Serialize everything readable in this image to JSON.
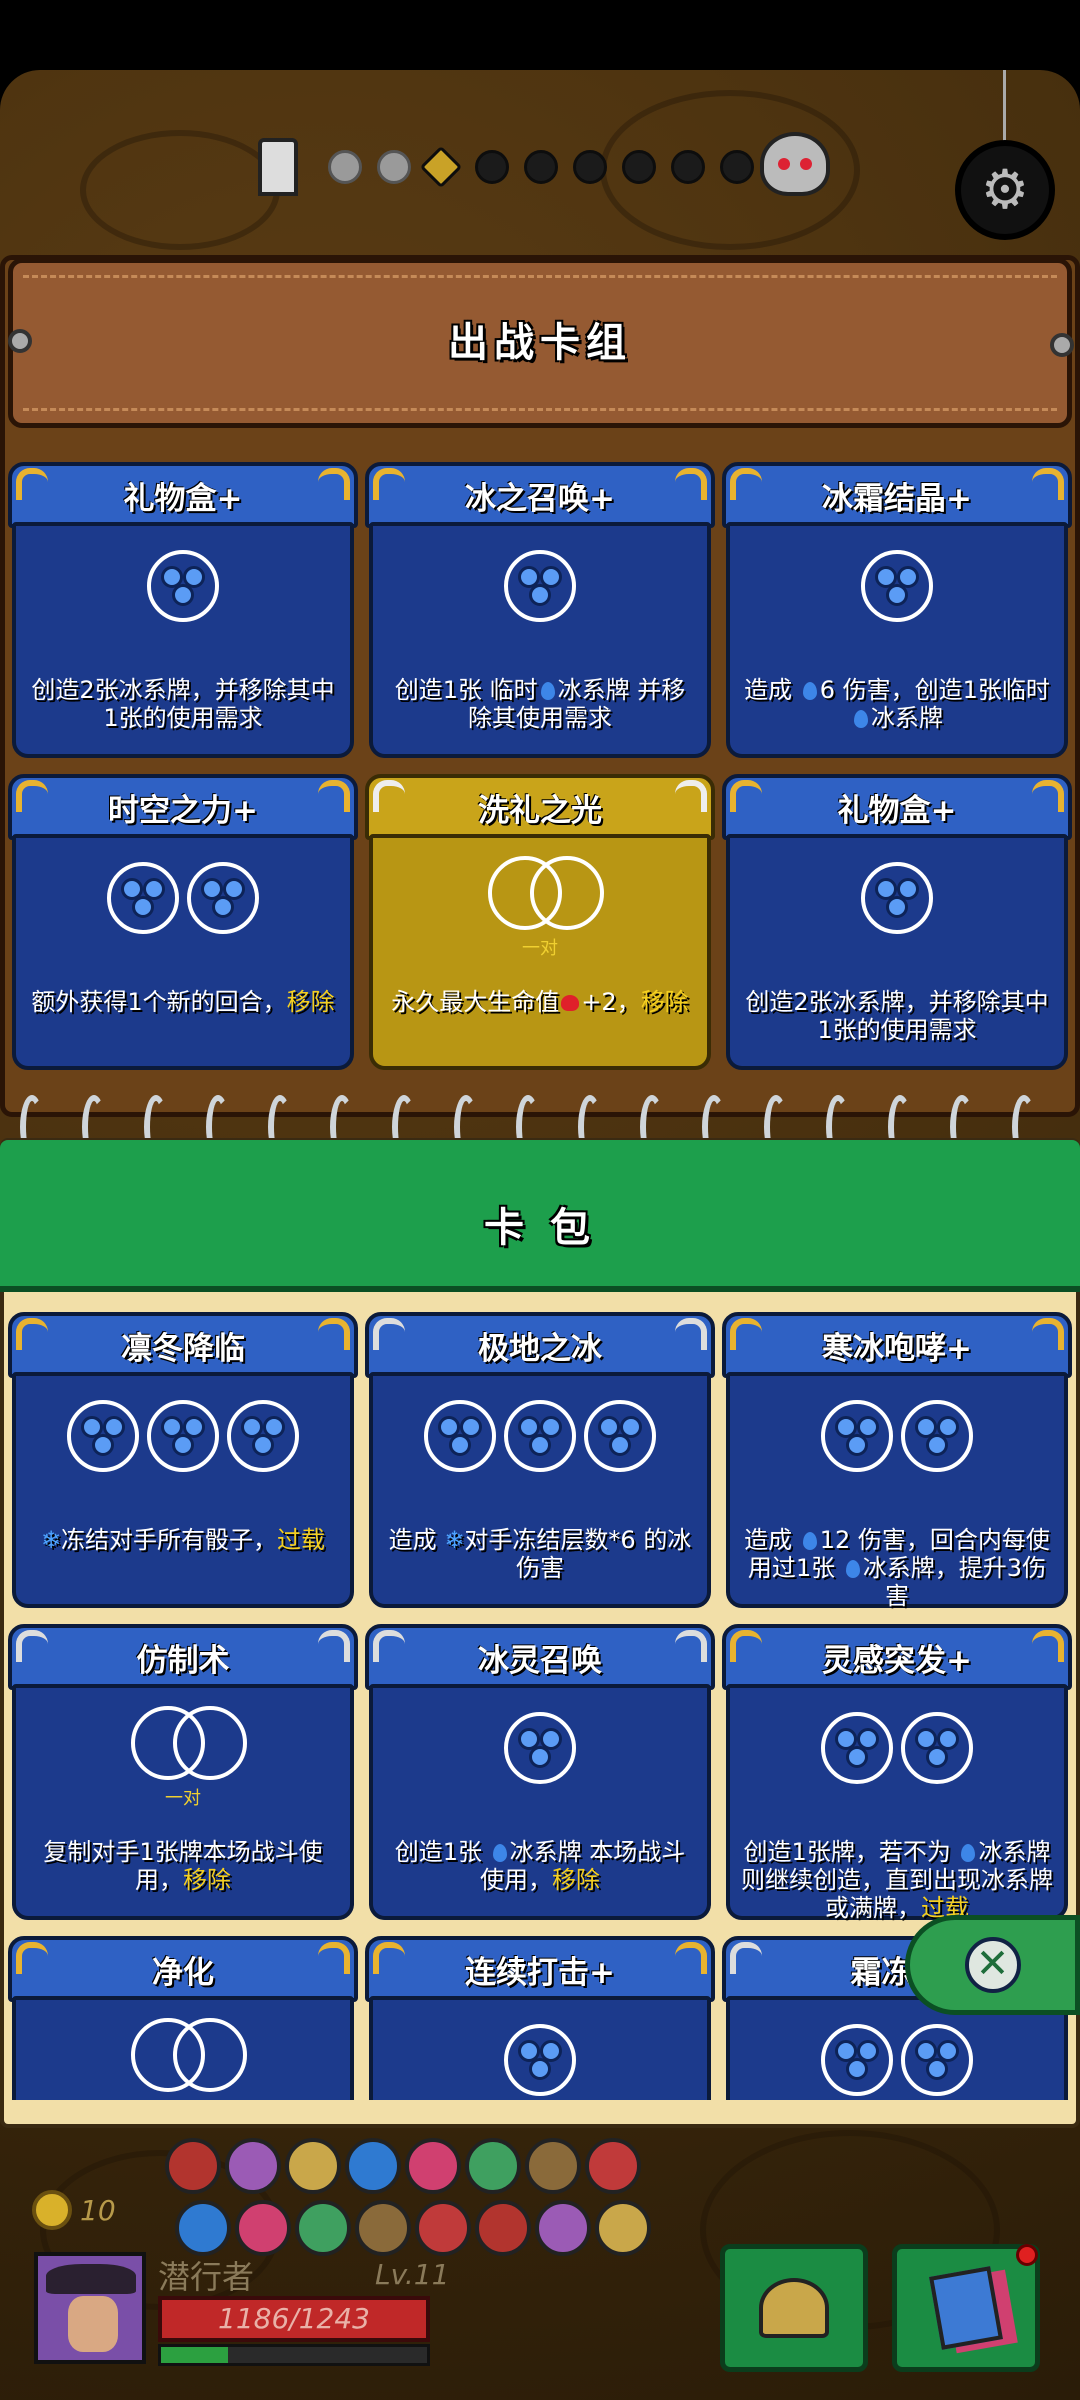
{
  "map": {
    "stages": [
      "done",
      "done",
      "current",
      "locked",
      "locked",
      "locked",
      "locked",
      "locked",
      "locked"
    ]
  },
  "deck": {
    "title": "出战卡组",
    "cards": [
      {
        "name": "礼物盒+",
        "slots": [
          "ice"
        ],
        "desc": "创造2张冰系牌，并移除其中1张的使用需求",
        "variant": "blue"
      },
      {
        "name": "冰之召唤+",
        "slots": [
          "ice"
        ],
        "desc": "创造1张 临时💧冰系牌 并移除其使用需求",
        "variant": "blue"
      },
      {
        "name": "冰霜结晶+",
        "slots": [
          "ice"
        ],
        "desc": "造成 💧6 伤害，创造1张临时💧冰系牌",
        "variant": "blue"
      },
      {
        "name": "时空之力+",
        "slots": [
          "ice",
          "ice"
        ],
        "desc": "额外获得1个新的回合，",
        "highlight": "移除",
        "variant": "blue"
      },
      {
        "name": "洗礼之光",
        "slots": [
          "pair"
        ],
        "pair_label": "一对",
        "desc": "永久最大生命值❤+2，",
        "highlight": "移除",
        "variant": "gold"
      },
      {
        "name": "礼物盒+",
        "slots": [
          "ice"
        ],
        "desc": "创造2张冰系牌，并移除其中1张的使用需求",
        "variant": "blue"
      }
    ]
  },
  "pack": {
    "title": "卡 包",
    "cards": [
      {
        "name": "凛冬降临",
        "slots": [
          "ice",
          "ice",
          "ice"
        ],
        "desc": "❄冻结对手所有骰子，",
        "highlight": "过载",
        "variant": "blue"
      },
      {
        "name": "极地之冰",
        "slots": [
          "ice",
          "ice",
          "ice"
        ],
        "desc": "造成 ❄对手冻结层数*6 的冰伤害",
        "variant": "plain"
      },
      {
        "name": "寒冰咆哮+",
        "slots": [
          "ice",
          "ice"
        ],
        "desc": "造成 💧12 伤害，回合内每使用过1张 💧冰系牌，提升3伤害",
        "variant": "blue"
      },
      {
        "name": "仿制术",
        "slots": [
          "pair"
        ],
        "pair_label": "一对",
        "desc": "复制对手1张牌本场战斗使用，",
        "highlight": "移除",
        "variant": "plain"
      },
      {
        "name": "冰灵召唤",
        "slots": [
          "ice"
        ],
        "desc": "创造1张 💧冰系牌 本场战斗使用，",
        "highlight": "移除",
        "variant": "plain"
      },
      {
        "name": "灵感突发+",
        "slots": [
          "ice",
          "ice"
        ],
        "desc": "创造1张牌，若不为 💧冰系牌则继续创造，直到出现冰系牌或满牌，",
        "highlight": "过载",
        "variant": "blue"
      },
      {
        "name": "净化",
        "slots": [
          "pair"
        ],
        "pair_label": "一对",
        "desc": "",
        "variant": "blue"
      },
      {
        "name": "连续打击+",
        "slots": [
          "ice"
        ],
        "desc": "",
        "variant": "blue"
      },
      {
        "name": "霜冻结",
        "slots": [
          "ice",
          "ice"
        ],
        "desc": "",
        "variant": "plain"
      }
    ]
  },
  "player": {
    "coins": "10",
    "name": "潜行者",
    "level": "Lv.11",
    "hp": "1186/1243",
    "xp_fraction": 0.25
  },
  "icons": {
    "close": "close-icon",
    "settings": "gear-icon",
    "equipment": "helmet-icon",
    "deck": "cards-icon"
  },
  "colors": {
    "card_blue": "#2f61c4",
    "card_gold": "#c9a41a",
    "pack_green": "#1d9f4c",
    "deck_brown": "#955a32",
    "hp_red": "#c02828"
  }
}
